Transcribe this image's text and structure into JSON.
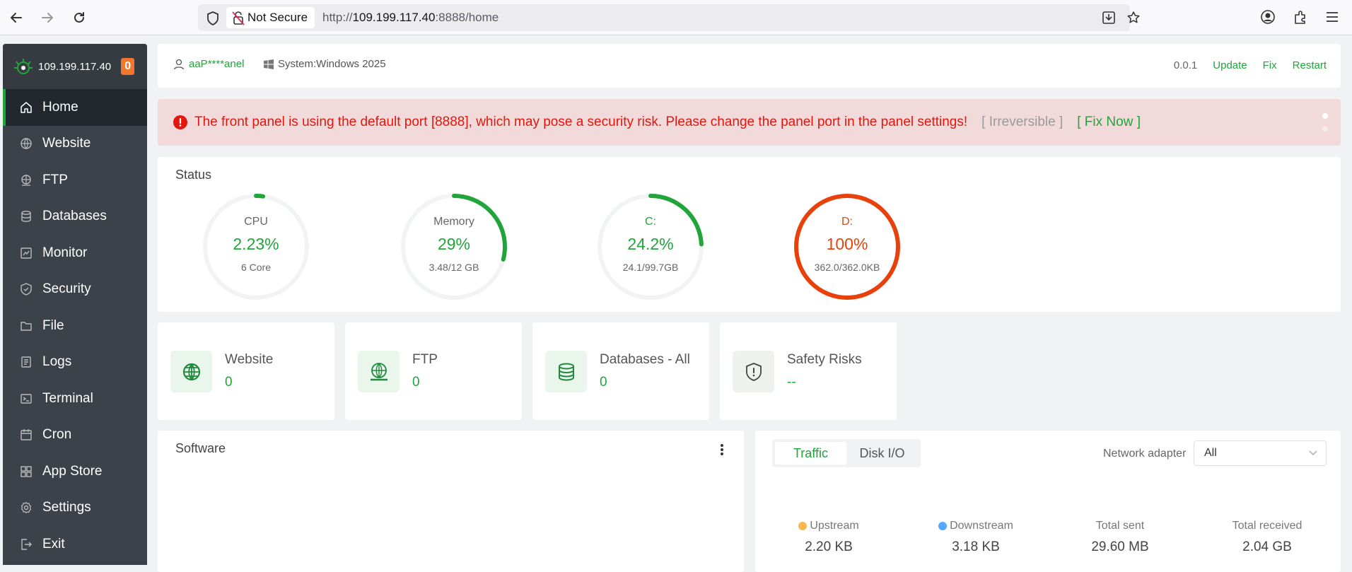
{
  "browser": {
    "security_label": "Not Secure",
    "url_prefix": "http://",
    "url_host": "109.199.117.40",
    "url_suffix": ":8888/home"
  },
  "sidebar": {
    "server_ip": "109.199.117.40",
    "badge_count": "0",
    "items": [
      {
        "label": "Home",
        "icon": "home-icon",
        "active": true
      },
      {
        "label": "Website",
        "icon": "globe-icon"
      },
      {
        "label": "FTP",
        "icon": "ftp-icon"
      },
      {
        "label": "Databases",
        "icon": "database-icon"
      },
      {
        "label": "Monitor",
        "icon": "monitor-icon"
      },
      {
        "label": "Security",
        "icon": "shield-icon"
      },
      {
        "label": "File",
        "icon": "folder-icon"
      },
      {
        "label": "Logs",
        "icon": "logs-icon"
      },
      {
        "label": "Terminal",
        "icon": "terminal-icon"
      },
      {
        "label": "Cron",
        "icon": "cron-icon"
      },
      {
        "label": "App Store",
        "icon": "app-store-icon"
      },
      {
        "label": "Settings",
        "icon": "gear-icon"
      },
      {
        "label": "Exit",
        "icon": "exit-icon"
      }
    ]
  },
  "topbar": {
    "username": "aaP****anel",
    "system": "System:Windows 2025",
    "version": "0.0.1",
    "update": "Update",
    "fix": "Fix",
    "restart": "Restart"
  },
  "alert": {
    "text": "The front panel is using the default port [8888], which may pose a security risk. Please change the panel port in the panel settings!",
    "irreversible": "[ Irreversible ]",
    "fix_now": "[ Fix Now ]"
  },
  "status": {
    "title": "Status",
    "gauges": [
      {
        "label": "CPU",
        "value": "2.23%",
        "sub": "6 Core",
        "percent": 2.23,
        "color": "#20a53a"
      },
      {
        "label": "Memory",
        "value": "29%",
        "sub": "3.48/12 GB",
        "percent": 29,
        "color": "#20a53a"
      },
      {
        "label": "C:",
        "value": "24.2%",
        "sub": "24.1/99.7GB",
        "percent": 24.2,
        "color": "#20a53a"
      },
      {
        "label": "D:",
        "value": "100%",
        "sub": "362.0/362.0KB",
        "percent": 100,
        "color": "#e9410c"
      }
    ]
  },
  "overview": [
    {
      "title": "Website",
      "value": "0",
      "icon": "globe-icon"
    },
    {
      "title": "FTP",
      "value": "0",
      "icon": "ftp-icon"
    },
    {
      "title": "Databases - All",
      "value": "0",
      "icon": "database-icon"
    },
    {
      "title": "Safety Risks",
      "value": "--",
      "icon": "shield-alert-icon"
    }
  ],
  "software": {
    "title": "Software"
  },
  "traffic": {
    "tabs": [
      "Traffic",
      "Disk I/O"
    ],
    "adapter_label": "Network adapter",
    "adapter_value": "All",
    "stats": [
      {
        "label": "Upstream",
        "value": "2.20 KB",
        "dot": "#f7b851"
      },
      {
        "label": "Downstream",
        "value": "3.18 KB",
        "dot": "#52a9ff"
      },
      {
        "label": "Total sent",
        "value": "29.60 MB"
      },
      {
        "label": "Total received",
        "value": "2.04 GB"
      }
    ]
  }
}
